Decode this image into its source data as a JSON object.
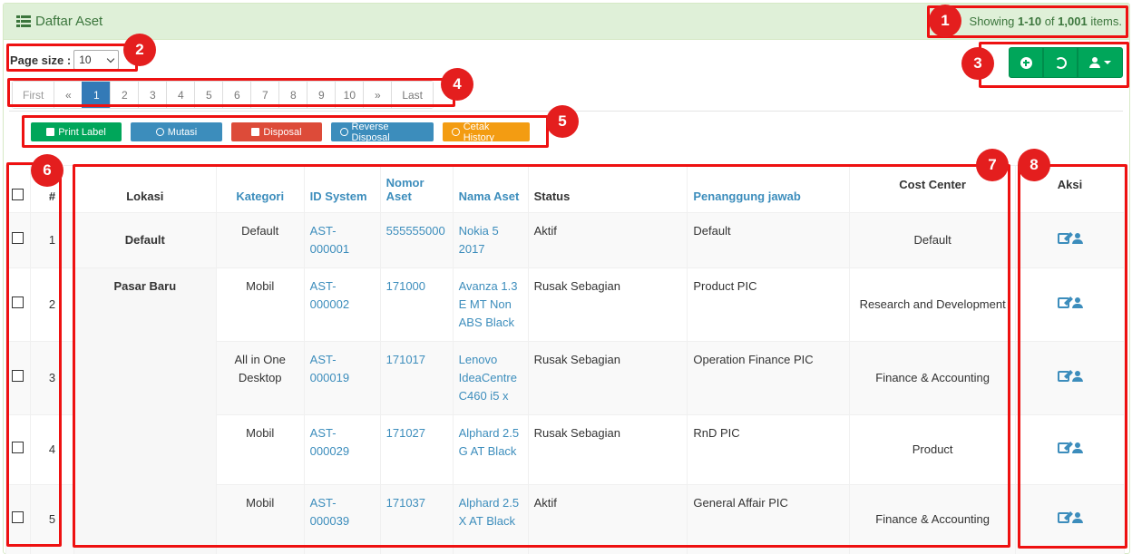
{
  "header": {
    "title": "Daftar Aset",
    "summary_prefix": "Showing",
    "summary_range": "1-10",
    "summary_of": "of",
    "summary_total": "1,001",
    "summary_suffix": "items."
  },
  "page_size": {
    "label": "Page size :",
    "value": "10"
  },
  "pagination": [
    "First",
    "«",
    "1",
    "2",
    "3",
    "4",
    "5",
    "6",
    "7",
    "8",
    "9",
    "10",
    "»",
    "Last"
  ],
  "pagination_active": "1",
  "actions": {
    "print_label": "Print Label",
    "mutasi": "Mutasi",
    "disposal": "Disposal",
    "reverse_disposal": "Reverse Disposal",
    "cetak_history": "Cetak History"
  },
  "table": {
    "headers": {
      "no": "#",
      "lokasi": "Lokasi",
      "kategori": "Kategori",
      "id_system": "ID System",
      "nomor_aset": "Nomor Aset",
      "nama_aset": "Nama Aset",
      "status": "Status",
      "penanggung_jawab": "Penanggung jawab",
      "cost_center": "Cost Center",
      "aksi": "Aksi"
    },
    "rows": [
      {
        "no": "1",
        "lokasi": "Default",
        "kategori": "Default",
        "id_system": "AST-000001",
        "nomor_aset": "555555000",
        "nama_aset": "Nokia 5 2017",
        "status": "Aktif",
        "penanggung_jawab": "Default",
        "cost_center": "Default"
      },
      {
        "no": "2",
        "lokasi": "Pasar Baru",
        "kategori": "Mobil",
        "id_system": "AST-000002",
        "nomor_aset": "171000",
        "nama_aset": "Avanza 1.3 E MT  Non ABS Black",
        "status": "Rusak Sebagian",
        "penanggung_jawab": "Product PIC",
        "cost_center": "Research and Development"
      },
      {
        "no": "3",
        "lokasi": "",
        "kategori": "All in One Desktop",
        "id_system": "AST-000019",
        "nomor_aset": "171017",
        "nama_aset": "Lenovo IdeaCentre C460 i5 x",
        "status": "Rusak Sebagian",
        "penanggung_jawab": "Operation Finance PIC",
        "cost_center": "Finance & Accounting"
      },
      {
        "no": "4",
        "lokasi": "",
        "kategori": "Mobil",
        "id_system": "AST-000029",
        "nomor_aset": "171027",
        "nama_aset": "Alphard 2.5 G AT Black",
        "status": "Rusak Sebagian",
        "penanggung_jawab": "RnD PIC",
        "cost_center": "Product"
      },
      {
        "no": "5",
        "lokasi": "",
        "kategori": "Mobil",
        "id_system": "AST-000039",
        "nomor_aset": "171037",
        "nama_aset": "Alphard 2.5 X AT Black",
        "status": "Aktif",
        "penanggung_jawab": "General Affair PIC",
        "cost_center": "Finance & Accounting"
      }
    ]
  },
  "callouts": [
    "1",
    "2",
    "3",
    "4",
    "5",
    "6",
    "7",
    "8"
  ],
  "icons": {
    "title": "list-icon",
    "add": "plus-circle-icon",
    "refresh": "refresh-icon",
    "export": "user-export-icon",
    "edit": "edit-icon",
    "assign": "user-icon"
  },
  "colors": {
    "green": "#00a65a",
    "blue": "#3c8dbc",
    "red": "#dd4b39",
    "orange": "#f39c12",
    "active_page": "#337ab7",
    "callout": "#e41e1e"
  }
}
